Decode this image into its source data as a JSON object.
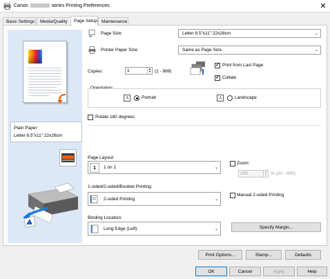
{
  "window": {
    "title_prefix": "Canon",
    "title_suffix": "series Printing Preferences",
    "close_glyph": "✕"
  },
  "tabs": [
    {
      "label": "Basic Settings",
      "active": false
    },
    {
      "label": "Media/Quality",
      "active": false
    },
    {
      "label": "Page Setup",
      "active": true
    },
    {
      "label": "Maintenance",
      "active": false
    }
  ],
  "preview": {
    "paper_type": "Plain Paper",
    "paper_size": "Letter 8.5\"x11\" 22x28cm"
  },
  "page_setup": {
    "page_size_label": "Page Size:",
    "page_size_value": "Letter 8.5\"x11\" 22x28cm",
    "printer_paper_size_label": "Printer Paper Size:",
    "printer_paper_size_value": "Same as Page Size",
    "copies_label": "Copies:",
    "copies_value": "1",
    "copies_range": "(1 - 999)",
    "print_from_last_page_label": "Print from Last Page",
    "print_from_last_page_checked": true,
    "collate_label": "Collate",
    "collate_checked": true,
    "orientation_label": "Orientation:",
    "portrait_label": "Portrait",
    "landscape_label": "Landscape",
    "orientation_selected": "Portrait",
    "rotate_label": "Rotate 180 degrees",
    "rotate_checked": false,
    "page_layout_label": "Page Layout:",
    "page_layout_value": "1 on 1",
    "zoom_label": "Zoom:",
    "zoom_checked": false,
    "zoom_value": "100",
    "zoom_range": "% (20 - 400)",
    "sided_label": "1-sided/2-sided/Booklet Printing:",
    "sided_value": "2-sided Printing",
    "manual_2sided_label": "Manual 2-sided Printing",
    "manual_2sided_checked": false,
    "binding_label": "Binding Location:",
    "binding_value": "Long Edge (Left)",
    "specify_margin_label": "Specify Margin..."
  },
  "footer": {
    "print_options_label": "Print Options...",
    "stamp_label": "Stamp...",
    "defaults_label": "Defaults",
    "ok_label": "OK",
    "cancel_label": "Cancel",
    "apply_label": "Apply",
    "help_label": "Help"
  },
  "colors": {
    "preview_bg": "#dce8f5",
    "accent": "#0078d7"
  }
}
